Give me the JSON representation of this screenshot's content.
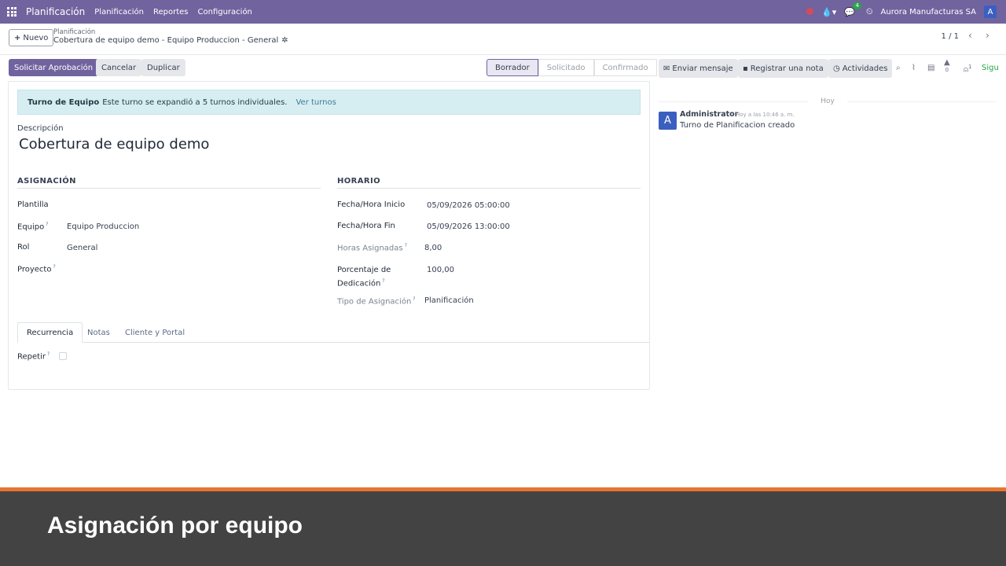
{
  "topnav": {
    "app_name": "Planificación",
    "menu": [
      "Planificación",
      "Reportes",
      "Configuración"
    ],
    "messages_badge": "4",
    "company": "Aurora Manufacturas SA",
    "user_initial": "A"
  },
  "control_panel": {
    "new_button": "Nuevo",
    "breadcrumb_parent": "Planificación",
    "record_title": "Cobertura de equipo demo - Equipo Produccion - General",
    "pager": "1 / 1"
  },
  "actions": {
    "request_approval": "Solicitar Aprobación",
    "cancel": "Cancelar",
    "duplicate": "Duplicar"
  },
  "statusbar": {
    "stages": [
      "Borrador",
      "Solicitado",
      "Confirmado"
    ],
    "active_stage": "Borrador"
  },
  "alert": {
    "title": "Turno de Equipo",
    "text": "Este turno se expandió a 5 turnos individuales.",
    "link": "Ver turnos"
  },
  "form": {
    "description_label": "Descripción",
    "description_value": "Cobertura de equipo demo",
    "assignment": {
      "title": "ASIGNACIÓN",
      "template_label": "Plantilla",
      "team_label": "Equipo",
      "team_value": "Equipo Produccion",
      "role_label": "Rol",
      "role_value": "General",
      "project_label": "Proyecto"
    },
    "schedule": {
      "title": "HORARIO",
      "start_label": "Fecha/Hora Inicio",
      "start_value": "05/09/2026 05:00:00",
      "end_label": "Fecha/Hora Fin",
      "end_value": "05/09/2026 13:00:00",
      "hours_label": "Horas Asignadas",
      "hours_value": "8,00",
      "dedication_label_1": "Porcentaje de",
      "dedication_label_2": "Dedicación",
      "dedication_value": "100,00",
      "assignment_type_label": "Tipo de Asignación",
      "assignment_type_value": "Planificación"
    },
    "tabs": [
      "Recurrencia",
      "Notas",
      "Cliente y Portal"
    ],
    "repeat_label": "Repetir"
  },
  "chatter": {
    "send_message": "Enviar mensaje",
    "log_note": "Registrar una nota",
    "activities": "Actividades",
    "activity_count": "0",
    "followers_count": "1",
    "follow": "Sigu",
    "day": "Hoy",
    "author": "Administrator",
    "date": "Hoy a las 10:46 a. m.",
    "body": "Turno de Planificacion creado",
    "author_initial": "A"
  },
  "caption": "Asignación por equipo",
  "colors": {
    "brand": "#71639e",
    "accent_orange": "#e9742f",
    "caption_bg": "#434343",
    "success": "#28a745"
  }
}
